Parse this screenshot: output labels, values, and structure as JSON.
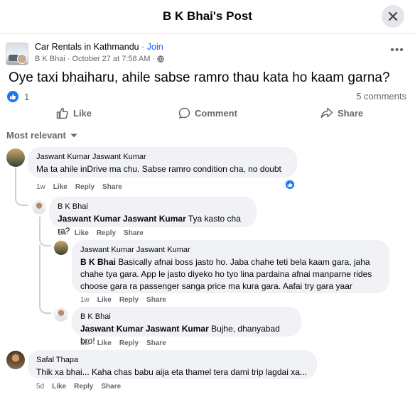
{
  "header": {
    "title": "B K Bhai's Post"
  },
  "post": {
    "page_name": "Car Rentals in Kathmandu",
    "separator": "·",
    "join_label": "Join",
    "author": "B K Bhai",
    "meta_sep": "·",
    "date": "October 27 at 7:58 AM",
    "meta_sep2": "·",
    "audience_icon": "globe-icon",
    "text": "Oye taxi bhaiharu, ahile sabse ramro thau kata ho kaam garna?",
    "reaction_count": "1",
    "comments_count": "5 comments"
  },
  "actions": {
    "like": "Like",
    "comment": "Comment",
    "share": "Share"
  },
  "filter": {
    "label": "Most relevant"
  },
  "comments": [
    {
      "author": "Jaswant Kumar Jaswant Kumar",
      "mention": "",
      "text": "Ma ta ahile inDrive ma chu. Sabse ramro condition cha, no doubt",
      "time": "1w",
      "like": "Like",
      "reply": "Reply",
      "share": "Share"
    },
    {
      "author": "B K Bhai",
      "mention": "Jaswant Kumar Jaswant Kumar",
      "text": " Tya kasto cha ra?",
      "time": "1w",
      "like": "Like",
      "reply": "Reply",
      "share": "Share"
    },
    {
      "author": "Jaswant Kumar Jaswant Kumar",
      "mention": "B K Bhai",
      "text": " Basically afnai boss jasto ho. Jaba chahe teti bela kaam gara, jaha chahe tya gara. App le jasto diyeko ho tyo lina pardaina afnai manparne rides choose gara ra passenger sanga price ma kura gara. Aafai try gara yaar",
      "time": "1w",
      "like": "Like",
      "reply": "Reply",
      "share": "Share"
    },
    {
      "author": "B K Bhai",
      "mention": "Jaswant Kumar Jaswant Kumar",
      "text": " Bujhe, dhanyabad bro!",
      "time": "1w",
      "like": "Like",
      "reply": "Reply",
      "share": "Share"
    },
    {
      "author": "Safal Thapa",
      "mention": "",
      "text": "Thik xa bhai... Kaha chas babu aija eta thamel tera dami trip lagdai xa...",
      "time": "5d",
      "like": "Like",
      "reply": "Reply",
      "share": "Share"
    }
  ],
  "colors": {
    "accent": "#0866ff",
    "like_blue": "#1877f2",
    "bubble": "#f0f2f5",
    "muted": "#65676b"
  }
}
